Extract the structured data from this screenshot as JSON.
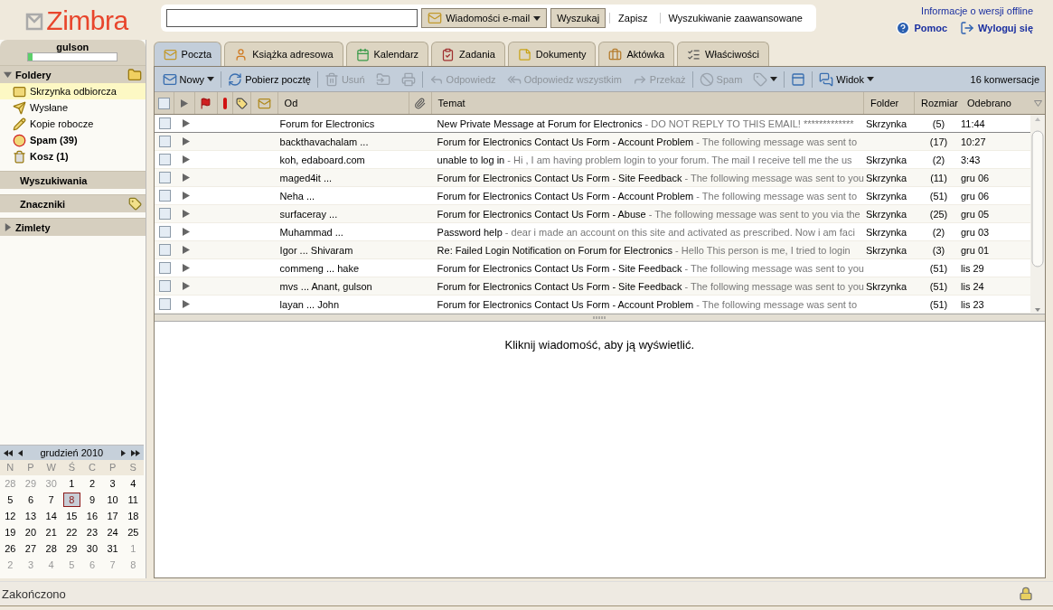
{
  "logo": {
    "text": "Zimbra"
  },
  "search": {
    "type_menu": "Wiadomości e-mail",
    "buttons": [
      "Wyszukaj"
    ],
    "links": [
      "Zapisz",
      "Wyszukiwanie zaawansowane"
    ]
  },
  "top_links": {
    "offline": "Informacje o wersji offline",
    "help": "Pomoc",
    "logout": "Wyloguj się"
  },
  "user": {
    "name": "gulson",
    "quota": {
      "level": 0.05
    }
  },
  "folders_section": {
    "title": "Foldery",
    "expanded": true
  },
  "folders": [
    {
      "kind": "inbox",
      "label": "Skrzynka odbiorcza",
      "bold": false,
      "selected": true
    },
    {
      "kind": "sent",
      "label": "Wysłane",
      "bold": false,
      "selected": false
    },
    {
      "kind": "drafts",
      "label": "Kopie robocze",
      "bold": false,
      "selected": false
    },
    {
      "kind": "spam",
      "label": "Spam (39)",
      "bold": true,
      "selected": false
    },
    {
      "kind": "trash",
      "label": "Kosz (1)",
      "bold": true,
      "selected": false
    }
  ],
  "searches_section": {
    "title": "Wyszukiwania"
  },
  "tags_section": {
    "title": "Znaczniki"
  },
  "zimlets_section": {
    "title": "Zimlety",
    "expanded": false
  },
  "calendar": {
    "month": "grudzień 2010",
    "weekdays": [
      "N",
      "P",
      "W",
      "Ś",
      "C",
      "P",
      "S"
    ],
    "weeks": [
      [
        {
          "day": "28",
          "other": true,
          "selected": false
        },
        {
          "day": "29",
          "other": true,
          "selected": false
        },
        {
          "day": "30",
          "other": true,
          "selected": false
        },
        {
          "day": "1",
          "other": false,
          "selected": false
        },
        {
          "day": "2",
          "other": false,
          "selected": false
        },
        {
          "day": "3",
          "other": false,
          "selected": false
        },
        {
          "day": "4",
          "other": false,
          "selected": false
        }
      ],
      [
        {
          "day": "5",
          "other": false,
          "selected": false
        },
        {
          "day": "6",
          "other": false,
          "selected": false
        },
        {
          "day": "7",
          "other": false,
          "selected": false
        },
        {
          "day": "8",
          "other": false,
          "selected": true
        },
        {
          "day": "9",
          "other": false,
          "selected": false
        },
        {
          "day": "10",
          "other": false,
          "selected": false
        },
        {
          "day": "11",
          "other": false,
          "selected": false
        }
      ],
      [
        {
          "day": "12",
          "other": false,
          "selected": false
        },
        {
          "day": "13",
          "other": false,
          "selected": false
        },
        {
          "day": "14",
          "other": false,
          "selected": false
        },
        {
          "day": "15",
          "other": false,
          "selected": false
        },
        {
          "day": "16",
          "other": false,
          "selected": false
        },
        {
          "day": "17",
          "other": false,
          "selected": false
        },
        {
          "day": "18",
          "other": false,
          "selected": false
        }
      ],
      [
        {
          "day": "19",
          "other": false,
          "selected": false
        },
        {
          "day": "20",
          "other": false,
          "selected": false
        },
        {
          "day": "21",
          "other": false,
          "selected": false
        },
        {
          "day": "22",
          "other": false,
          "selected": false
        },
        {
          "day": "23",
          "other": false,
          "selected": false
        },
        {
          "day": "24",
          "other": false,
          "selected": false
        },
        {
          "day": "25",
          "other": false,
          "selected": false
        }
      ],
      [
        {
          "day": "26",
          "other": false,
          "selected": false
        },
        {
          "day": "27",
          "other": false,
          "selected": false
        },
        {
          "day": "28",
          "other": false,
          "selected": false
        },
        {
          "day": "29",
          "other": false,
          "selected": false
        },
        {
          "day": "30",
          "other": false,
          "selected": false
        },
        {
          "day": "31",
          "other": false,
          "selected": false
        },
        {
          "day": "1",
          "other": true,
          "selected": false
        }
      ],
      [
        {
          "day": "2",
          "other": true,
          "selected": false
        },
        {
          "day": "3",
          "other": true,
          "selected": false
        },
        {
          "day": "4",
          "other": true,
          "selected": false
        },
        {
          "day": "5",
          "other": true,
          "selected": false
        },
        {
          "day": "6",
          "other": true,
          "selected": false
        },
        {
          "day": "7",
          "other": true,
          "selected": false
        },
        {
          "day": "8",
          "other": true,
          "selected": false
        }
      ]
    ]
  },
  "tabs": [
    {
      "kind": "mail",
      "label": "Poczta",
      "selected": true
    },
    {
      "kind": "contacts",
      "label": "Książka adresowa",
      "selected": false
    },
    {
      "kind": "calendar",
      "label": "Kalendarz",
      "selected": false
    },
    {
      "kind": "tasks",
      "label": "Zadania",
      "selected": false
    },
    {
      "kind": "documents",
      "label": "Dokumenty",
      "selected": false
    },
    {
      "kind": "briefcase",
      "label": "Aktówka",
      "selected": false
    },
    {
      "kind": "preferences",
      "label": "Właściwości",
      "selected": false
    }
  ],
  "toolbar": [
    {
      "kind": "new",
      "label": "Nowy",
      "disabled": false,
      "menu": true
    },
    {
      "kind": "fetch",
      "label": "Pobierz pocztę",
      "disabled": false,
      "menu": false
    },
    {
      "kind": "delete",
      "label": "Usuń",
      "disabled": true,
      "menu": false
    },
    {
      "kind": "move",
      "disabled": true,
      "menu": false
    },
    {
      "kind": "print",
      "disabled": true,
      "menu": false
    },
    {
      "kind": "reply",
      "label": "Odpowiedz",
      "disabled": true,
      "menu": false
    },
    {
      "kind": "replyall",
      "label": "Odpowiedz wszystkim",
      "disabled": true,
      "menu": false
    },
    {
      "kind": "forward",
      "label": "Przekaż",
      "disabled": true,
      "menu": false
    },
    {
      "kind": "spam",
      "label": "Spam",
      "disabled": true,
      "menu": false
    },
    {
      "kind": "tag",
      "disabled": true,
      "menu": true
    },
    {
      "kind": "window",
      "disabled": false,
      "menu": false
    },
    {
      "kind": "view",
      "label": "Widok",
      "disabled": false,
      "menu": true
    }
  ],
  "conversation_count": "16 konwersacje",
  "table": {
    "all_checked": false,
    "columns": [
      "Od",
      "Temat",
      "Folder",
      "Rozmiar",
      "Odebrano"
    ],
    "rows": [
      {
        "from": "Forum for Electronics",
        "subject": "New Private Message at Forum for Electronics",
        "fragment": " - DO NOT REPLY TO THIS EMAIL! *************",
        "folder": "Skrzynka",
        "size": "(5)",
        "date": "11:44",
        "checked": false
      },
      {
        "from": "backthavachalam ...",
        "subject": "Forum for Electronics Contact Us Form - Account Problem",
        "fragment": " - The following message was sent to",
        "size": "(17)",
        "date": "10:27",
        "checked": false
      },
      {
        "from": "koh, edaboard.com",
        "subject": "unable to log in",
        "fragment": " - Hi , I am having problem login to your forum. The mail I receive tell me the us",
        "folder": "Skrzynka",
        "size": "(2)",
        "date": "3:43",
        "checked": false
      },
      {
        "from": "maged4it ...",
        "subject": "Forum for Electronics Contact Us Form - Site Feedback",
        "fragment": " - The following message was sent to you",
        "folder": "Skrzynka",
        "size": "(11)",
        "date": "gru 06",
        "checked": false
      },
      {
        "from": "Neha ...",
        "subject": "Forum for Electronics Contact Us Form - Account Problem",
        "fragment": " - The following message was sent to",
        "folder": "Skrzynka",
        "size": "(51)",
        "date": "gru 06",
        "checked": false
      },
      {
        "from": "surfaceray ...",
        "subject": "Forum for Electronics Contact Us Form - Abuse",
        "fragment": " - The following message was sent to you via the",
        "folder": "Skrzynka",
        "size": "(25)",
        "date": "gru 05",
        "checked": false
      },
      {
        "from": "Muhammad ...",
        "subject": "Password help",
        "fragment": " - dear i made an account on this site and activated as prescribed. Now i am faci",
        "folder": "Skrzynka",
        "size": "(2)",
        "date": "gru 03",
        "checked": false
      },
      {
        "from": "Igor ... Shivaram",
        "subject": "Re: Failed Login Notification on Forum for Electronics",
        "fragment": " - Hello This person is me, I tried to login",
        "folder": "Skrzynka",
        "size": "(3)",
        "date": "gru 01",
        "checked": false
      },
      {
        "from": "commeng ... hake",
        "subject": "Forum for Electronics Contact Us Form - Site Feedback",
        "fragment": " - The following message was sent to you",
        "size": "(51)",
        "date": "lis 29",
        "checked": false
      },
      {
        "from": "mvs ... Anant, gulson",
        "subject": "Forum for Electronics Contact Us Form - Site Feedback",
        "fragment": " - The following message was sent to you",
        "folder": "Skrzynka",
        "size": "(51)",
        "date": "lis 24",
        "checked": false
      },
      {
        "from": "layan ... John",
        "subject": "Forum for Electronics Contact Us Form - Account Problem",
        "fragment": " - The following message was sent to",
        "size": "(51)",
        "date": "lis 23",
        "checked": false
      }
    ]
  },
  "reading_pane": {
    "message": "Kliknij wiadomość, aby ją wyświetlić."
  },
  "status_bar": {
    "text": "Zakończono"
  }
}
